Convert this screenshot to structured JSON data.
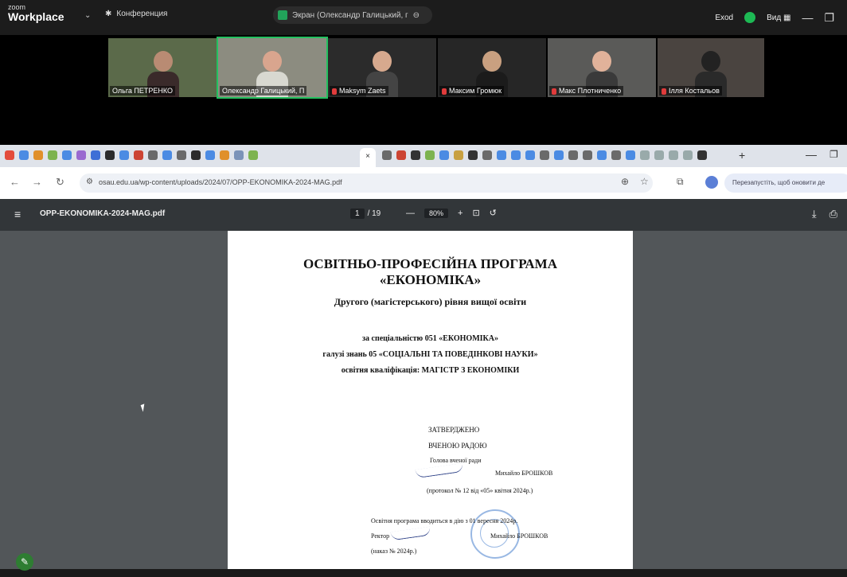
{
  "zoom": {
    "logo_small": "zoom",
    "logo_big": "Workplace",
    "menu_label": "Конференция",
    "sharing_label": "Экран (Олександр Галицький, г",
    "exit_label": "Exod",
    "view_label": "Вид"
  },
  "participants": [
    {
      "name": "Ольга ПЕТРЕНКО"
    },
    {
      "name": "Олександр Галицький, П"
    },
    {
      "name": "Maksym Zaets"
    },
    {
      "name": "Максим Громюк"
    },
    {
      "name": "Макс Плотниченко"
    },
    {
      "name": "Ілля Костальов"
    }
  ],
  "browser": {
    "url": "osau.edu.ua/wp-content/uploads/2024/07/OPP-EKONOMIKA-2024-MAG.pdf",
    "update_label": "Перезапустіть, щоб оновити де",
    "tab_close": "×",
    "tab_plus": "+"
  },
  "pdf": {
    "file_name": "OPP-EKONOMIKA-2024-MAG.pdf",
    "page_current": "1",
    "page_total": "/ 19",
    "zoom": "80%"
  },
  "document": {
    "title_line1": "ОСВІТНЬО-ПРОФЕСІЙНА ПРОГРАМА",
    "title_line2": "«ЕКОНОМІКА»",
    "subtitle": "Другого (магістерського) рівня вищої освіти",
    "line_specialty": "за спеціальністю 051 «ЕКОНОМІКА»",
    "line_field": "галузі знань 05 «СОЦІАЛЬНІ ТА ПОВЕДІНКОВІ НАУКИ»",
    "line_qualification": "освітня кваліфікація: МАГІСТР З ЕКОНОМІКИ",
    "approved": "ЗАТВЕРДЖЕНО",
    "council": "ВЧЕНОЮ РАДОЮ",
    "head": "Голова вченої ради",
    "signer": "Михайло БРОШКОВ",
    "protocol": "(протокол № 12 від «05» квітня 2024р.)",
    "intro_line": "Освітня програма вводиться в дію з 01 вересня 2024р.",
    "rector_line": "Ректор",
    "rector_name": "Михайло БРОШКОВ",
    "order_line": "(наказ № 2024р.)"
  }
}
